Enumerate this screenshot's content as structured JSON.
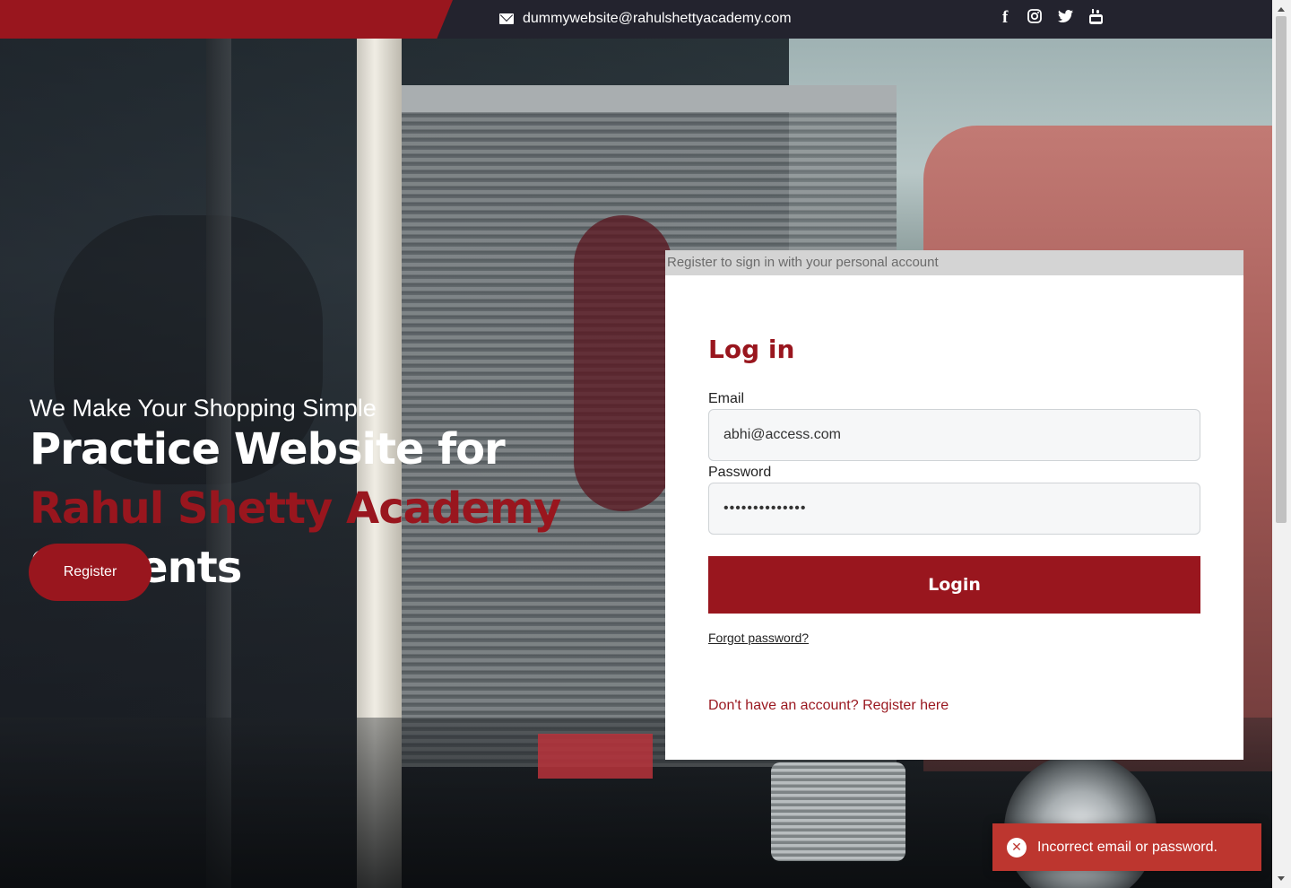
{
  "topbar": {
    "email": "dummywebsite@rahulshettyacademy.com",
    "social_icons": [
      "facebook-icon",
      "instagram-icon",
      "twitter-icon",
      "youtube-icon"
    ]
  },
  "hero": {
    "tagline": "We Make Your Shopping Simple",
    "headline_part1": "Practice Website for ",
    "headline_accent": "Rahul Shetty Academy",
    "headline_part2": " Students",
    "register_label": "Register"
  },
  "login": {
    "strip_text": "Register to sign in with your personal account",
    "title": "Log in",
    "email_label": "Email",
    "email_value": "abhi@access.com",
    "password_label": "Password",
    "password_value": "••••••••••••••",
    "login_label": "Login",
    "forgot_label": "Forgot password?",
    "register_link": "Don't have an account? Register here"
  },
  "toast": {
    "message": "Incorrect email or password."
  },
  "colors": {
    "brand_red": "#99161e",
    "toast_red": "#bd362f",
    "topbar_dark": "#23232e"
  }
}
